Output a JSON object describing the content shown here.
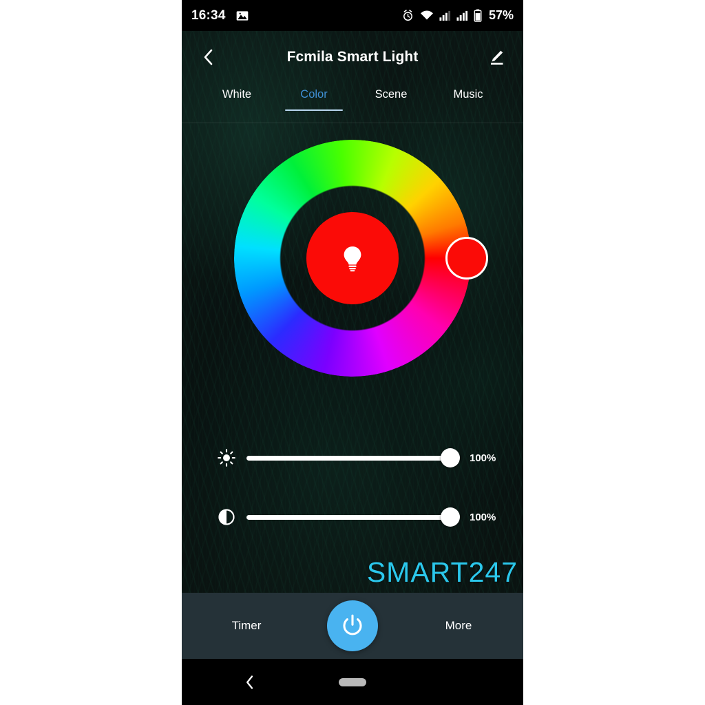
{
  "status_bar": {
    "time": "16:34",
    "battery_percent": "57%",
    "icons": [
      "photo-icon",
      "alarm-icon",
      "wifi-icon",
      "signal-sim1-icon",
      "signal-sim2-icon",
      "battery-icon"
    ]
  },
  "header": {
    "title": "Fcmila Smart Light",
    "back_icon": "chevron-left-icon",
    "edit_icon": "pencil-edit-icon"
  },
  "tabs": {
    "items": [
      {
        "label": "White",
        "active": false
      },
      {
        "label": "Color",
        "active": true
      },
      {
        "label": "Scene",
        "active": false
      },
      {
        "label": "Music",
        "active": false
      }
    ],
    "active_color": "#3f8fd4",
    "indicator_color": "#b9d6ef"
  },
  "color_wheel": {
    "selected_color": "#fb0b07",
    "center_icon": "light-bulb-icon",
    "handle_angle_deg": 0,
    "handle_label": "color-picker-handle"
  },
  "sliders": [
    {
      "name": "brightness",
      "icon": "brightness-sun-icon",
      "value": "100%",
      "percent": 100
    },
    {
      "name": "saturation",
      "icon": "contrast-half-circle-icon",
      "value": "100%",
      "percent": 100
    }
  ],
  "watermark": {
    "text": "SMART247",
    "color": "#2bc8ec"
  },
  "bottom_bar": {
    "timer_label": "Timer",
    "more_label": "More",
    "power_icon": "power-icon",
    "power_color": "#49b3f0",
    "background": "#253238"
  },
  "nav_bar": {
    "back_icon": "chevron-left-icon",
    "home_icon": "home-pill-icon"
  }
}
